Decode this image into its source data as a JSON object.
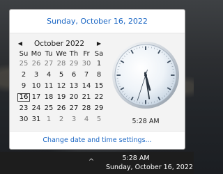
{
  "popup": {
    "long_date": "Sunday, October 16, 2022",
    "month_year": "October 2022",
    "prev_arrow": "◀",
    "next_arrow": "▶",
    "weekdays": [
      "Su",
      "Mo",
      "Tu",
      "We",
      "Th",
      "Fr",
      "Sa"
    ],
    "weeks": [
      [
        {
          "d": "25",
          "o": true
        },
        {
          "d": "26",
          "o": true
        },
        {
          "d": "27",
          "o": true
        },
        {
          "d": "28",
          "o": true
        },
        {
          "d": "29",
          "o": true
        },
        {
          "d": "30",
          "o": true
        },
        {
          "d": "1"
        }
      ],
      [
        {
          "d": "2"
        },
        {
          "d": "3"
        },
        {
          "d": "4"
        },
        {
          "d": "5"
        },
        {
          "d": "6"
        },
        {
          "d": "7"
        },
        {
          "d": "8"
        }
      ],
      [
        {
          "d": "9"
        },
        {
          "d": "10"
        },
        {
          "d": "11"
        },
        {
          "d": "12"
        },
        {
          "d": "13"
        },
        {
          "d": "14"
        },
        {
          "d": "15"
        }
      ],
      [
        {
          "d": "16",
          "t": true
        },
        {
          "d": "17"
        },
        {
          "d": "18"
        },
        {
          "d": "19"
        },
        {
          "d": "20"
        },
        {
          "d": "21"
        },
        {
          "d": "22"
        }
      ],
      [
        {
          "d": "23"
        },
        {
          "d": "24"
        },
        {
          "d": "25"
        },
        {
          "d": "26"
        },
        {
          "d": "27"
        },
        {
          "d": "28"
        },
        {
          "d": "29"
        }
      ],
      [
        {
          "d": "30"
        },
        {
          "d": "31"
        },
        {
          "d": "1",
          "o": true
        },
        {
          "d": "2",
          "o": true
        },
        {
          "d": "3",
          "o": true
        },
        {
          "d": "4",
          "o": true
        },
        {
          "d": "5",
          "o": true
        }
      ]
    ],
    "clock_time": "5:28 AM",
    "clock": {
      "hour": 5,
      "minute": 28,
      "second": 33
    },
    "footer_link": "Change date and time settings..."
  },
  "taskbar": {
    "chevron": "^",
    "time": "5:28 AM",
    "date": "Sunday, October 16, 2022"
  },
  "colors": {
    "link": "#1a66c4",
    "other_month": "#7a7a7a",
    "taskbar_bg": "#1d1d1d"
  },
  "icons": {
    "prev": "chevron-left-icon",
    "next": "chevron-right-icon",
    "tray": "chevron-up-icon"
  }
}
